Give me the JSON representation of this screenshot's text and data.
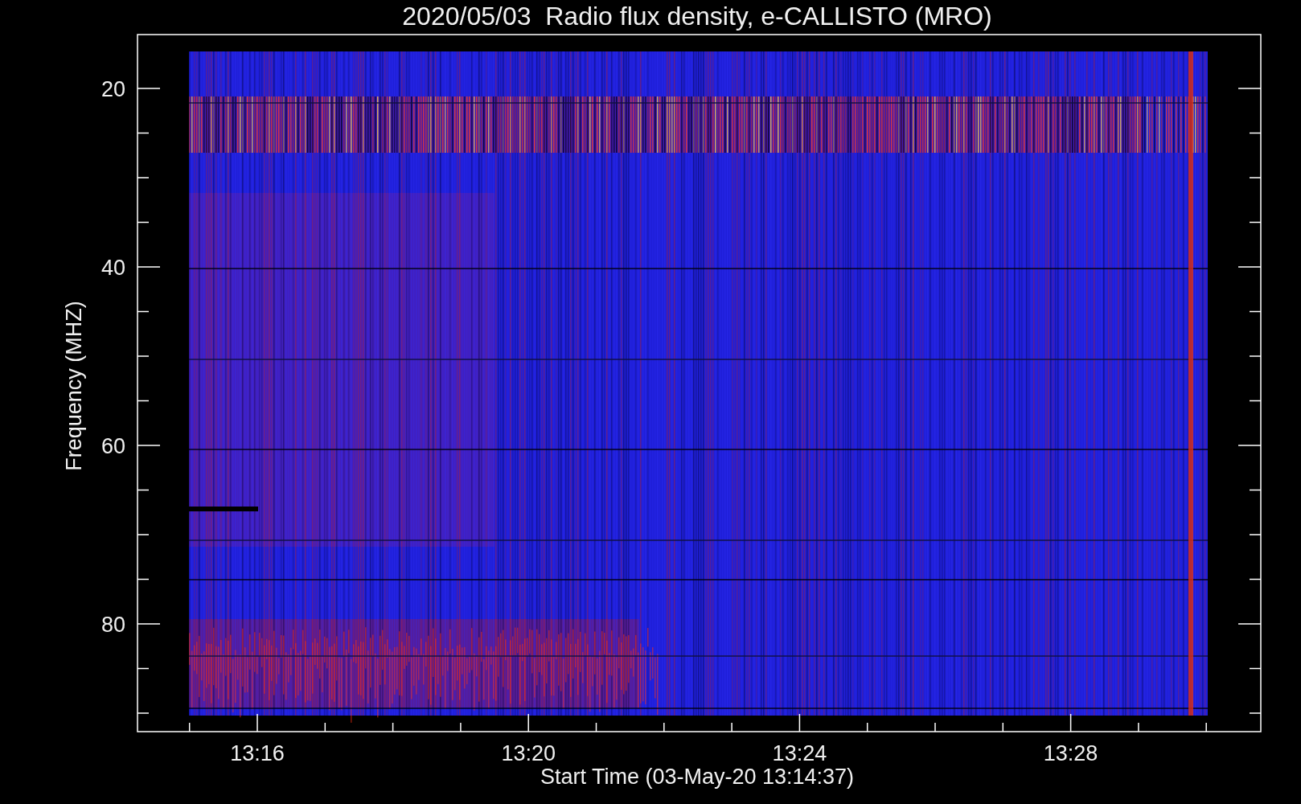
{
  "title": "2020/05/03  Radio flux density, e-CALLISTO (MRO)",
  "plot": {
    "kind": "spectrogram",
    "y_axis": {
      "label": "Frequency (MHZ)",
      "ticks": [
        "20",
        "40",
        "60",
        "80"
      ]
    },
    "x_axis": {
      "label": "Start Time (03-May-20 13:14:37)",
      "ticks": [
        "13:16",
        "13:20",
        "13:24",
        "13:28"
      ]
    }
  }
}
